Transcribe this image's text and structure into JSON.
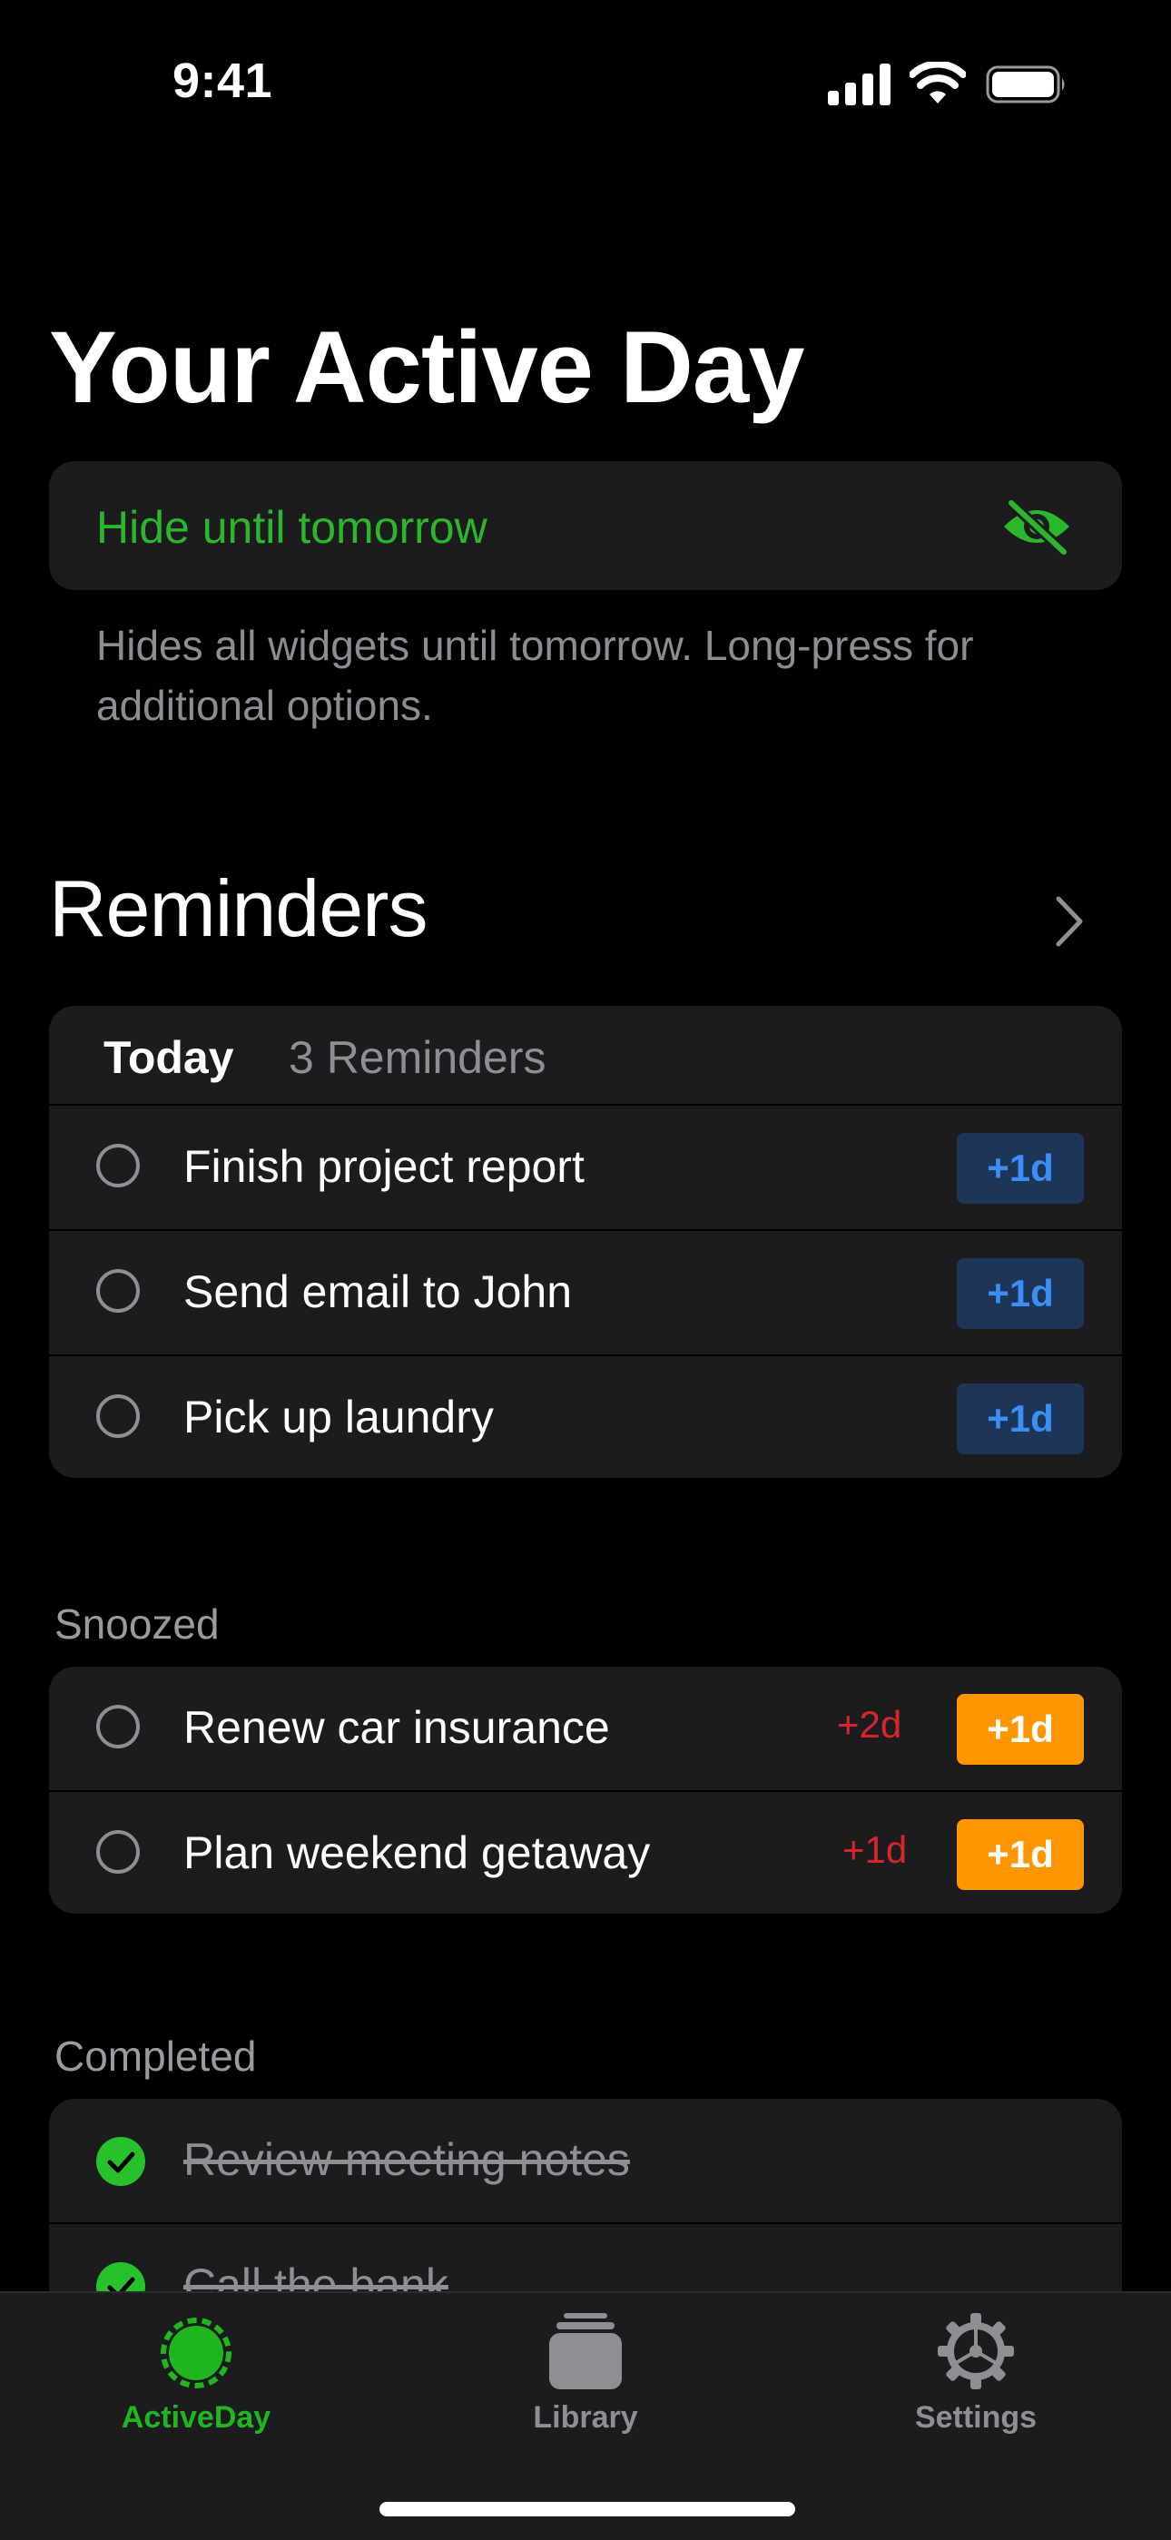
{
  "status_bar": {
    "time": "9:41"
  },
  "page": {
    "title": "Your Active Day"
  },
  "hide_card": {
    "label": "Hide until tomorrow",
    "icon": "eye-slash-icon",
    "help_text": "Hides all widgets until tomorrow. Long-press for additional options."
  },
  "reminders": {
    "section_title": "Reminders",
    "today": {
      "label": "Today",
      "count_text": "3 Reminders",
      "items": [
        {
          "title": "Finish project report",
          "button": "+1d"
        },
        {
          "title": "Send email to John",
          "button": "+1d"
        },
        {
          "title": "Pick up laundry",
          "button": "+1d"
        }
      ]
    },
    "snoozed": {
      "label": "Snoozed",
      "items": [
        {
          "title": "Renew car insurance",
          "delay": "+2d",
          "button": "+1d"
        },
        {
          "title": "Plan weekend getaway",
          "delay": "+1d",
          "button": "+1d"
        }
      ]
    },
    "completed": {
      "label": "Completed",
      "items": [
        {
          "title": "Review meeting notes"
        },
        {
          "title": "Call the bank"
        }
      ]
    }
  },
  "tab_bar": {
    "tabs": [
      {
        "label": "ActiveDay",
        "icon": "active-day-icon",
        "active": true
      },
      {
        "label": "Library",
        "icon": "library-icon",
        "active": false
      },
      {
        "label": "Settings",
        "icon": "gear-icon",
        "active": false
      }
    ]
  },
  "colors": {
    "accent_green": "#2bb62b",
    "blue_button_bg": "#1d3556",
    "blue_button_text": "#3a8ef6",
    "orange_button": "#ff9500",
    "red_delay": "#d7262b",
    "card_bg": "#1c1c1e"
  }
}
